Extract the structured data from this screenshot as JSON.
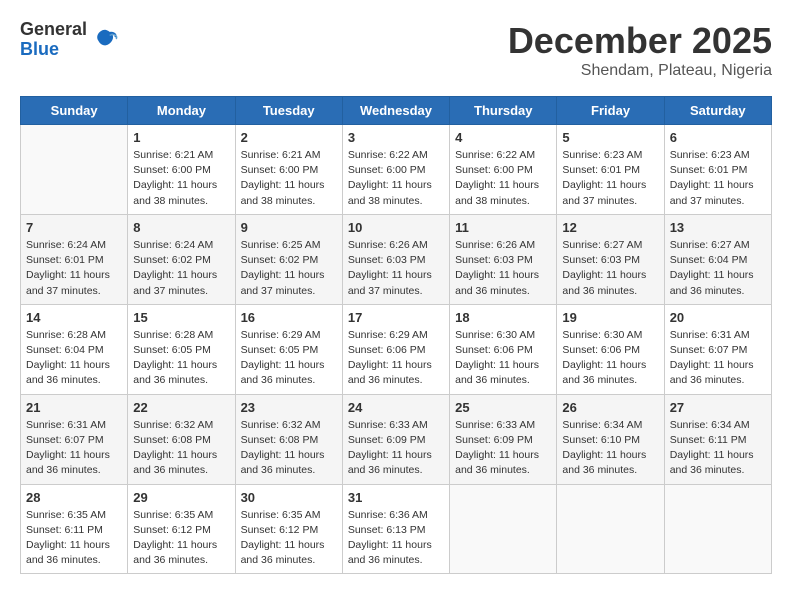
{
  "header": {
    "logo_general": "General",
    "logo_blue": "Blue",
    "title": "December 2025",
    "subtitle": "Shendam, Plateau, Nigeria"
  },
  "days_of_week": [
    "Sunday",
    "Monday",
    "Tuesday",
    "Wednesday",
    "Thursday",
    "Friday",
    "Saturday"
  ],
  "weeks": [
    [
      {
        "day": "",
        "info": ""
      },
      {
        "day": "1",
        "info": "Sunrise: 6:21 AM\nSunset: 6:00 PM\nDaylight: 11 hours and 38 minutes."
      },
      {
        "day": "2",
        "info": "Sunrise: 6:21 AM\nSunset: 6:00 PM\nDaylight: 11 hours and 38 minutes."
      },
      {
        "day": "3",
        "info": "Sunrise: 6:22 AM\nSunset: 6:00 PM\nDaylight: 11 hours and 38 minutes."
      },
      {
        "day": "4",
        "info": "Sunrise: 6:22 AM\nSunset: 6:00 PM\nDaylight: 11 hours and 38 minutes."
      },
      {
        "day": "5",
        "info": "Sunrise: 6:23 AM\nSunset: 6:01 PM\nDaylight: 11 hours and 37 minutes."
      },
      {
        "day": "6",
        "info": "Sunrise: 6:23 AM\nSunset: 6:01 PM\nDaylight: 11 hours and 37 minutes."
      }
    ],
    [
      {
        "day": "7",
        "info": "Sunrise: 6:24 AM\nSunset: 6:01 PM\nDaylight: 11 hours and 37 minutes."
      },
      {
        "day": "8",
        "info": "Sunrise: 6:24 AM\nSunset: 6:02 PM\nDaylight: 11 hours and 37 minutes."
      },
      {
        "day": "9",
        "info": "Sunrise: 6:25 AM\nSunset: 6:02 PM\nDaylight: 11 hours and 37 minutes."
      },
      {
        "day": "10",
        "info": "Sunrise: 6:26 AM\nSunset: 6:03 PM\nDaylight: 11 hours and 37 minutes."
      },
      {
        "day": "11",
        "info": "Sunrise: 6:26 AM\nSunset: 6:03 PM\nDaylight: 11 hours and 36 minutes."
      },
      {
        "day": "12",
        "info": "Sunrise: 6:27 AM\nSunset: 6:03 PM\nDaylight: 11 hours and 36 minutes."
      },
      {
        "day": "13",
        "info": "Sunrise: 6:27 AM\nSunset: 6:04 PM\nDaylight: 11 hours and 36 minutes."
      }
    ],
    [
      {
        "day": "14",
        "info": "Sunrise: 6:28 AM\nSunset: 6:04 PM\nDaylight: 11 hours and 36 minutes."
      },
      {
        "day": "15",
        "info": "Sunrise: 6:28 AM\nSunset: 6:05 PM\nDaylight: 11 hours and 36 minutes."
      },
      {
        "day": "16",
        "info": "Sunrise: 6:29 AM\nSunset: 6:05 PM\nDaylight: 11 hours and 36 minutes."
      },
      {
        "day": "17",
        "info": "Sunrise: 6:29 AM\nSunset: 6:06 PM\nDaylight: 11 hours and 36 minutes."
      },
      {
        "day": "18",
        "info": "Sunrise: 6:30 AM\nSunset: 6:06 PM\nDaylight: 11 hours and 36 minutes."
      },
      {
        "day": "19",
        "info": "Sunrise: 6:30 AM\nSunset: 6:06 PM\nDaylight: 11 hours and 36 minutes."
      },
      {
        "day": "20",
        "info": "Sunrise: 6:31 AM\nSunset: 6:07 PM\nDaylight: 11 hours and 36 minutes."
      }
    ],
    [
      {
        "day": "21",
        "info": "Sunrise: 6:31 AM\nSunset: 6:07 PM\nDaylight: 11 hours and 36 minutes."
      },
      {
        "day": "22",
        "info": "Sunrise: 6:32 AM\nSunset: 6:08 PM\nDaylight: 11 hours and 36 minutes."
      },
      {
        "day": "23",
        "info": "Sunrise: 6:32 AM\nSunset: 6:08 PM\nDaylight: 11 hours and 36 minutes."
      },
      {
        "day": "24",
        "info": "Sunrise: 6:33 AM\nSunset: 6:09 PM\nDaylight: 11 hours and 36 minutes."
      },
      {
        "day": "25",
        "info": "Sunrise: 6:33 AM\nSunset: 6:09 PM\nDaylight: 11 hours and 36 minutes."
      },
      {
        "day": "26",
        "info": "Sunrise: 6:34 AM\nSunset: 6:10 PM\nDaylight: 11 hours and 36 minutes."
      },
      {
        "day": "27",
        "info": "Sunrise: 6:34 AM\nSunset: 6:11 PM\nDaylight: 11 hours and 36 minutes."
      }
    ],
    [
      {
        "day": "28",
        "info": "Sunrise: 6:35 AM\nSunset: 6:11 PM\nDaylight: 11 hours and 36 minutes."
      },
      {
        "day": "29",
        "info": "Sunrise: 6:35 AM\nSunset: 6:12 PM\nDaylight: 11 hours and 36 minutes."
      },
      {
        "day": "30",
        "info": "Sunrise: 6:35 AM\nSunset: 6:12 PM\nDaylight: 11 hours and 36 minutes."
      },
      {
        "day": "31",
        "info": "Sunrise: 6:36 AM\nSunset: 6:13 PM\nDaylight: 11 hours and 36 minutes."
      },
      {
        "day": "",
        "info": ""
      },
      {
        "day": "",
        "info": ""
      },
      {
        "day": "",
        "info": ""
      }
    ]
  ]
}
